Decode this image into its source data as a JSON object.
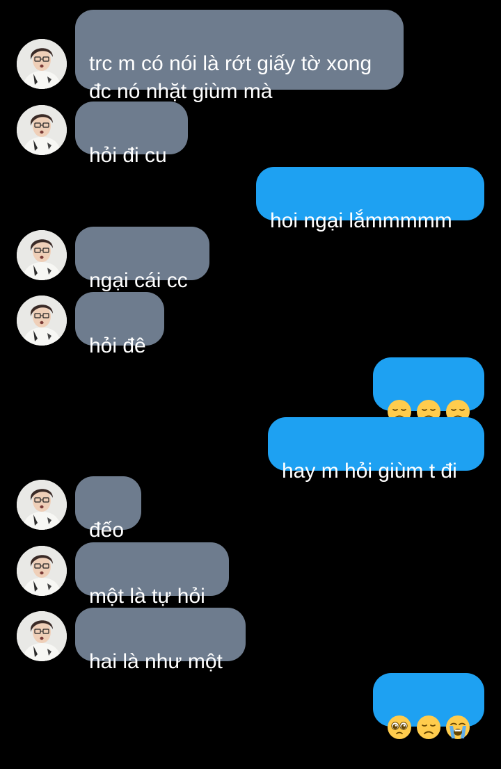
{
  "conversation": {
    "messages": [
      {
        "side": "in",
        "text": "trc m có nói là rớt giấy tờ xong\nđc nó nhặt giùm mà"
      },
      {
        "side": "in",
        "text": "hỏi đi cu"
      },
      {
        "side": "out",
        "text": "hoi ngại lắmmmmm"
      },
      {
        "side": "in",
        "text": "ngại cái cc"
      },
      {
        "side": "in",
        "text": "hỏi đê"
      },
      {
        "side": "out",
        "emojis": [
          "disappointed-face",
          "disappointed-face",
          "disappointed-face"
        ]
      },
      {
        "side": "out",
        "text": "hay m hỏi giùm t đi"
      },
      {
        "side": "in",
        "text": "đếo"
      },
      {
        "side": "in",
        "text": "một là tự hỏi"
      },
      {
        "side": "in",
        "text": "hai là như một"
      },
      {
        "side": "out",
        "emojis": [
          "pleading-face",
          "disappointed-face",
          "loudly-crying-face"
        ]
      }
    ]
  },
  "colors": {
    "background": "#000000",
    "incoming_bubble": "#6e7c8e",
    "outgoing_bubble": "#1ea1f2",
    "text": "#ffffff"
  }
}
